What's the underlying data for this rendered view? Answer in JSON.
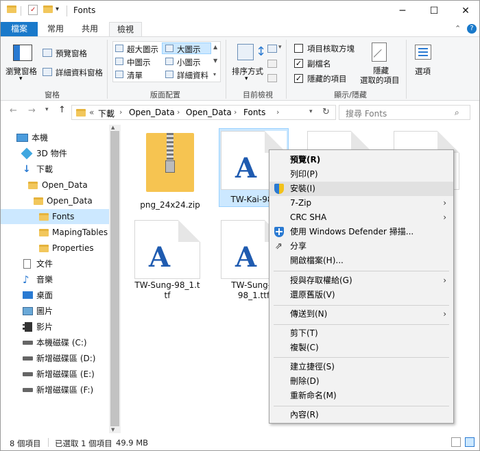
{
  "window": {
    "title": "Fonts",
    "minimize": "─",
    "maximize": "☐",
    "close": "✕",
    "help": "?"
  },
  "tabs": [
    {
      "label": "檔案",
      "active": false,
      "file": true
    },
    {
      "label": "常用"
    },
    {
      "label": "共用"
    },
    {
      "label": "檢視",
      "active": true
    }
  ],
  "ribbon": {
    "panes": {
      "nav_pane": "瀏覽窗格",
      "preview_pane": "預覽窗格",
      "details_pane": "詳細資料窗格",
      "group_label": "窗格"
    },
    "layout": {
      "items": [
        "超大圖示",
        "大圖示",
        "中圖示",
        "小圖示",
        "清單",
        "詳細資料"
      ],
      "group_label": "版面配置"
    },
    "current_view": {
      "sort_by": "排序方式",
      "group_label": "目前檢視"
    },
    "show_hide": {
      "item_checkboxes": "項目核取方塊",
      "file_extensions": "副檔名",
      "hidden_items": "隱藏的項目",
      "hide_selected": "隱藏\n選取的項目",
      "hide_line1": "隱藏",
      "hide_line2": "選取的項目",
      "group_label": "顯示/隱藏",
      "checked": {
        "item_checkboxes": false,
        "file_extensions": true,
        "hidden_items": true
      }
    },
    "options": "選項"
  },
  "address": {
    "prefix": "«",
    "crumbs": [
      "下載",
      "Open_Data",
      "Open_Data",
      "Fonts"
    ],
    "search_placeholder": "搜尋 Fonts"
  },
  "nav": [
    {
      "label": "本機",
      "icon": "computer-icon",
      "indent": 0
    },
    {
      "label": "3D 物件",
      "icon": "3d-objects-icon",
      "indent": 1
    },
    {
      "label": "下載",
      "icon": "download-icon",
      "indent": 1
    },
    {
      "label": "Open_Data",
      "icon": "folder-icon",
      "indent": 2
    },
    {
      "label": "Open_Data",
      "icon": "folder-icon",
      "indent": 3
    },
    {
      "label": "Fonts",
      "icon": "folder-icon",
      "indent": 4,
      "selected": true
    },
    {
      "label": "MapingTables",
      "icon": "folder-icon",
      "indent": 4
    },
    {
      "label": "Properties",
      "icon": "folder-icon",
      "indent": 4
    },
    {
      "label": "文件",
      "icon": "documents-icon",
      "indent": 1
    },
    {
      "label": "音樂",
      "icon": "music-icon",
      "indent": 1
    },
    {
      "label": "桌面",
      "icon": "desktop-icon",
      "indent": 1
    },
    {
      "label": "圖片",
      "icon": "pictures-icon",
      "indent": 1
    },
    {
      "label": "影片",
      "icon": "videos-icon",
      "indent": 1
    },
    {
      "label": "本機磁碟 (C:)",
      "icon": "drive-icon",
      "indent": 1
    },
    {
      "label": "新增磁碟區 (D:)",
      "icon": "drive-icon",
      "indent": 1
    },
    {
      "label": "新增磁碟區 (E:)",
      "icon": "drive-icon",
      "indent": 1
    },
    {
      "label": "新增磁碟區 (F:)",
      "icon": "drive-icon",
      "indent": 1
    }
  ],
  "files": [
    {
      "name": "png_24x24.zip",
      "type": "zip"
    },
    {
      "name": "TW-Kai-98_",
      "type": "font",
      "selected": true
    },
    {
      "name": "",
      "type": "doc"
    },
    {
      "name": "",
      "type": "doc"
    },
    {
      "name": "TW-Sung-98_1.ttf",
      "type": "font"
    },
    {
      "name": "TW-Sung-E\n98_1.ttf",
      "type": "font"
    }
  ],
  "file_labels": {
    "zip": "png_24x24.zip",
    "kai": "TW-Kai-98_",
    "sung_l1": "TW-Sung-98_1.t",
    "sung_l2": "tf",
    "sunge_l1": "TW-Sung-E",
    "sunge_l2": "98_1.ttf"
  },
  "context_menu": {
    "preview": "預覽(R)",
    "print": "列印(P)",
    "install": "安裝(I)",
    "zip7": "7-Zip",
    "crc": "CRC SHA",
    "defender": "使用 Windows Defender 掃描...",
    "share": "分享",
    "open_with": "開啟檔案(H)...",
    "grant_access": "授與存取權給(G)",
    "restore": "還原舊版(V)",
    "send_to": "傳送到(N)",
    "cut": "剪下(T)",
    "copy": "複製(C)",
    "shortcut": "建立捷徑(S)",
    "delete": "刪除(D)",
    "rename": "重新命名(M)",
    "properties": "內容(R)"
  },
  "status": {
    "count": "8 個項目",
    "selected": "已選取 1 個項目",
    "size": "49.9 MB"
  }
}
